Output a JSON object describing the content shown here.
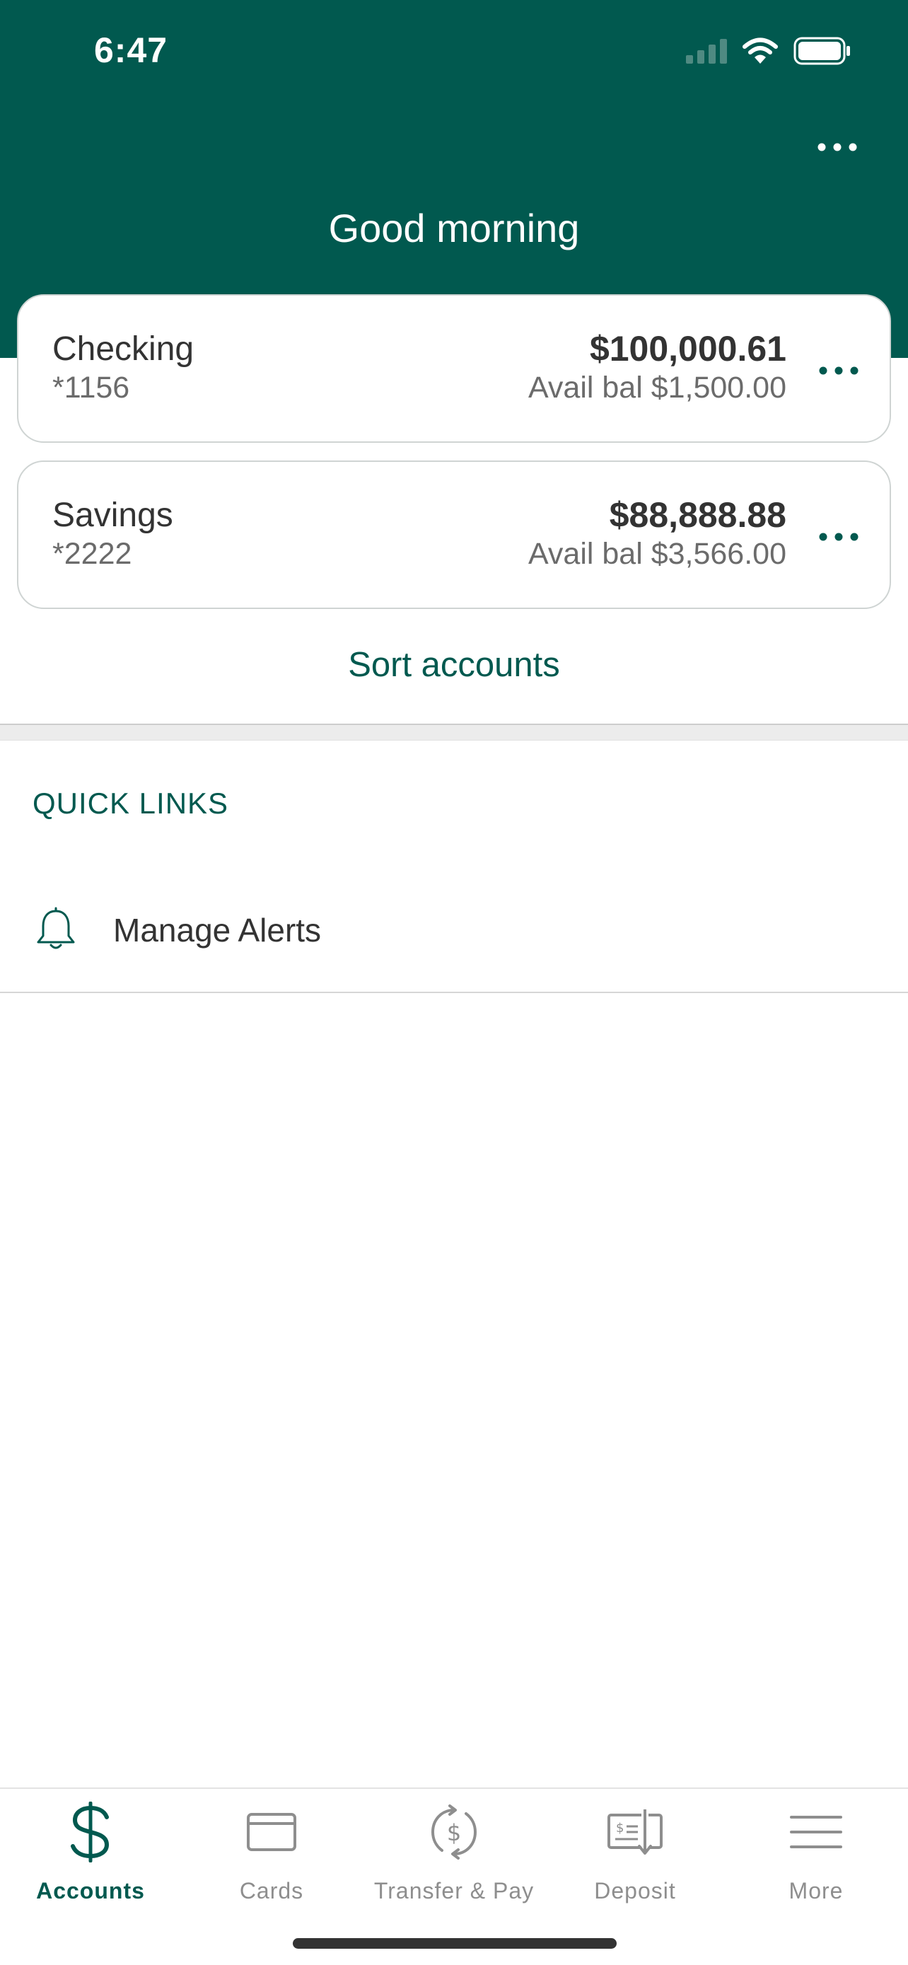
{
  "status_bar": {
    "time": "6:47"
  },
  "header": {
    "greeting": "Good morning"
  },
  "accounts": [
    {
      "name": "Checking",
      "number": "*1156",
      "balance": "$100,000.61",
      "available": "Avail bal $1,500.00"
    },
    {
      "name": "Savings",
      "number": "*2222",
      "balance": "$88,888.88",
      "available": "Avail bal $3,566.00"
    }
  ],
  "sort_accounts_label": "Sort accounts",
  "quick_links": {
    "title": "QUICK LINKS",
    "items": [
      {
        "label": "Manage Alerts",
        "icon": "bell-icon"
      }
    ]
  },
  "tab_bar": {
    "active": "Accounts",
    "tabs": [
      {
        "label": "Accounts",
        "icon": "dollar-icon"
      },
      {
        "label": "Cards",
        "icon": "card-icon"
      },
      {
        "label": "Transfer & Pay",
        "icon": "transfer-icon"
      },
      {
        "label": "Deposit",
        "icon": "check-deposit-icon"
      },
      {
        "label": "More",
        "icon": "menu-icon"
      }
    ]
  },
  "colors": {
    "brand": "#01594f",
    "inactive": "#8e8e8e",
    "text": "#333333"
  }
}
